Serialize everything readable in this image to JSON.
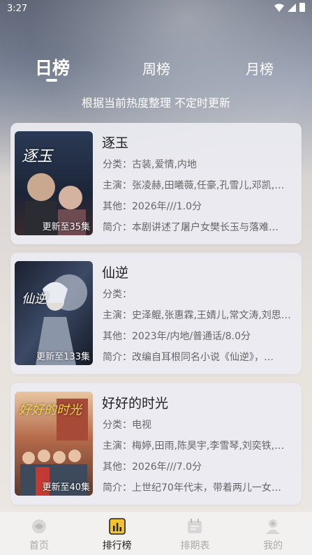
{
  "status_bar": {
    "time": "3:27"
  },
  "tabs": [
    {
      "label": "日榜"
    },
    {
      "label": "周榜"
    },
    {
      "label": "月榜"
    }
  ],
  "subtitle": "根据当前热度整理 不定时更新",
  "cards": [
    {
      "title": "逐玉",
      "badge": "更新至35集",
      "poster_text": "逐玉",
      "category": "分类：古装,爱情,内地",
      "cast": "主演：张凌赫,田曦薇,任豪,孔雪儿,邓凯,…",
      "other": "其他：2026年///1.0分",
      "intro": "简介：本剧讲述了屠户女樊长玉与落难…"
    },
    {
      "title": "仙逆",
      "badge": "更新至133集",
      "poster_text": "仙逆",
      "category": "分类：",
      "cast": "主演：史泽鲲,张惠霖,王婧儿,常文涛,刘思…",
      "other": "其他：2023年/内地/普通话/8.0分",
      "intro": "简介：改编自耳根同名小说《仙逆》，…"
    },
    {
      "title": "好好的时光",
      "badge": "更新至40集",
      "poster_text": "好好的时光",
      "category": "分类：电视",
      "cast": "主演：梅婷,田雨,陈昊宇,李雪琴,刘奕铁,…",
      "other": "其他：2026年///7.0分",
      "intro": "简介：上世纪70年代末，带着两儿一女…"
    }
  ],
  "bottom_nav": [
    {
      "label": "首页",
      "icon": "home-icon"
    },
    {
      "label": "排行榜",
      "icon": "ranking-icon"
    },
    {
      "label": "排期表",
      "icon": "schedule-icon"
    },
    {
      "label": "我的",
      "icon": "profile-icon"
    }
  ],
  "colors": {
    "active_nav": "#f2c230",
    "inactive": "#aaaaaa"
  }
}
